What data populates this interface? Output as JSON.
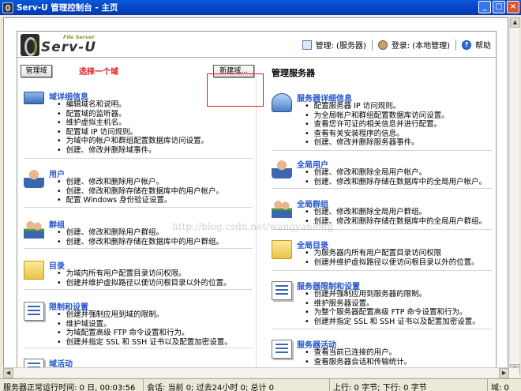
{
  "window": {
    "title": "Serv-U 管理控制台 - 主页"
  },
  "header": {
    "logo_small": "File Server",
    "logo": "Serv-U",
    "manage_label": "管理:",
    "manage_value": "(服务器)",
    "login_label": "登录:",
    "login_value": "(本地管理)",
    "help_label": "帮助"
  },
  "left": {
    "manage_domain_button": "管理域",
    "select_domain_hint": "选择一个域",
    "new_domain_button": "新建域...",
    "items": [
      {
        "title": "域详细信息",
        "icon": "monitor-icon",
        "bullets": [
          "编辑域名和说明。",
          "配置域的监听器。",
          "维护虚拟主机名。",
          "配置域 IP 访问规则。",
          "为域中的帐户和群组配置数据库访问设置。",
          "创建、修改并删除域事件。"
        ]
      },
      {
        "title": "用户",
        "icon": "user-icon",
        "bullets": [
          "创建、修改和删除用户帐户。",
          "创建、修改和删除存储在数据库中的用户帐户。",
          "配置 Windows 身份验证设置。"
        ]
      },
      {
        "title": "群组",
        "icon": "group-icon",
        "bullets": [
          "创建、修改和删除用户群组。",
          "创建、修改和删除存储在数据库中的用户群组。"
        ]
      },
      {
        "title": "目录",
        "icon": "folder-icon",
        "bullets": [
          "为域内所有用户配置目录访问权限。",
          "创建并维护虚拟路径以便访问根目录以外的位置。"
        ]
      },
      {
        "title": "限制和设置",
        "icon": "settings-list-icon",
        "bullets": [
          "创建并强制应用到域的限制。",
          "维护域设置。",
          "为域配置高级 FTP 命令设置和行为。",
          "创建并指定 SSL 和 SSH 证书以及配置加密设置。"
        ]
      },
      {
        "title": "域活动",
        "icon": "activity-icon",
        "bullets": []
      }
    ]
  },
  "right": {
    "title": "管理服务器",
    "items": [
      {
        "title": "服务器详细信息",
        "icon": "server-icon",
        "bullets": [
          "配置服务器 IP 访问规则。",
          "为全局帐户和群组配置数据库访问设置。",
          "查看您许可证的相关信息并进行配置。",
          "查看有关安装程序的信息。",
          "创建、修改并删除服务器事件。"
        ]
      },
      {
        "title": "全局用户",
        "icon": "user-icon",
        "bullets": [
          "创建、修改和删除全局用户帐户。",
          "创建、修改和删除存储在数据库中的全局用户帐户。"
        ]
      },
      {
        "title": "全局群组",
        "icon": "group-icon",
        "bullets": [
          "创建、修改和删除全局用户群组。",
          "创建、修改和删除存储在数据库中的全局用户群组。"
        ]
      },
      {
        "title": "全局目录",
        "icon": "folder-icon",
        "bullets": [
          "为服务器内所有用户配置目录访问权限",
          "创建并维护虚拟路径以便访问根目录以外的位置。"
        ]
      },
      {
        "title": "服务器限制和设置",
        "icon": "settings-list-icon",
        "bullets": [
          "创建并强制应用到服务器的限制。",
          "维护服务器设置。",
          "为整个服务器配置高级 FTP 命令设置和行为。",
          "创建并指定 SSL 和 SSH 证书以及配置加密设置。"
        ]
      },
      {
        "title": "服务器活动",
        "icon": "activity-icon",
        "bullets": [
          "查看当前已连接的用户。",
          "查看服务器会话和传输统计。"
        ]
      }
    ]
  },
  "watermark": "http://blog.csdn.net/wangyanlong",
  "statusbar": {
    "uptime": "服务器正常运行时间: 0 日, 00:03:56",
    "sessions": "会话: 当前 0; 过去24小时 0; 总计 0",
    "up": "上行: 0 字节; 下行: 0 字节",
    "domain": "域: 0"
  }
}
